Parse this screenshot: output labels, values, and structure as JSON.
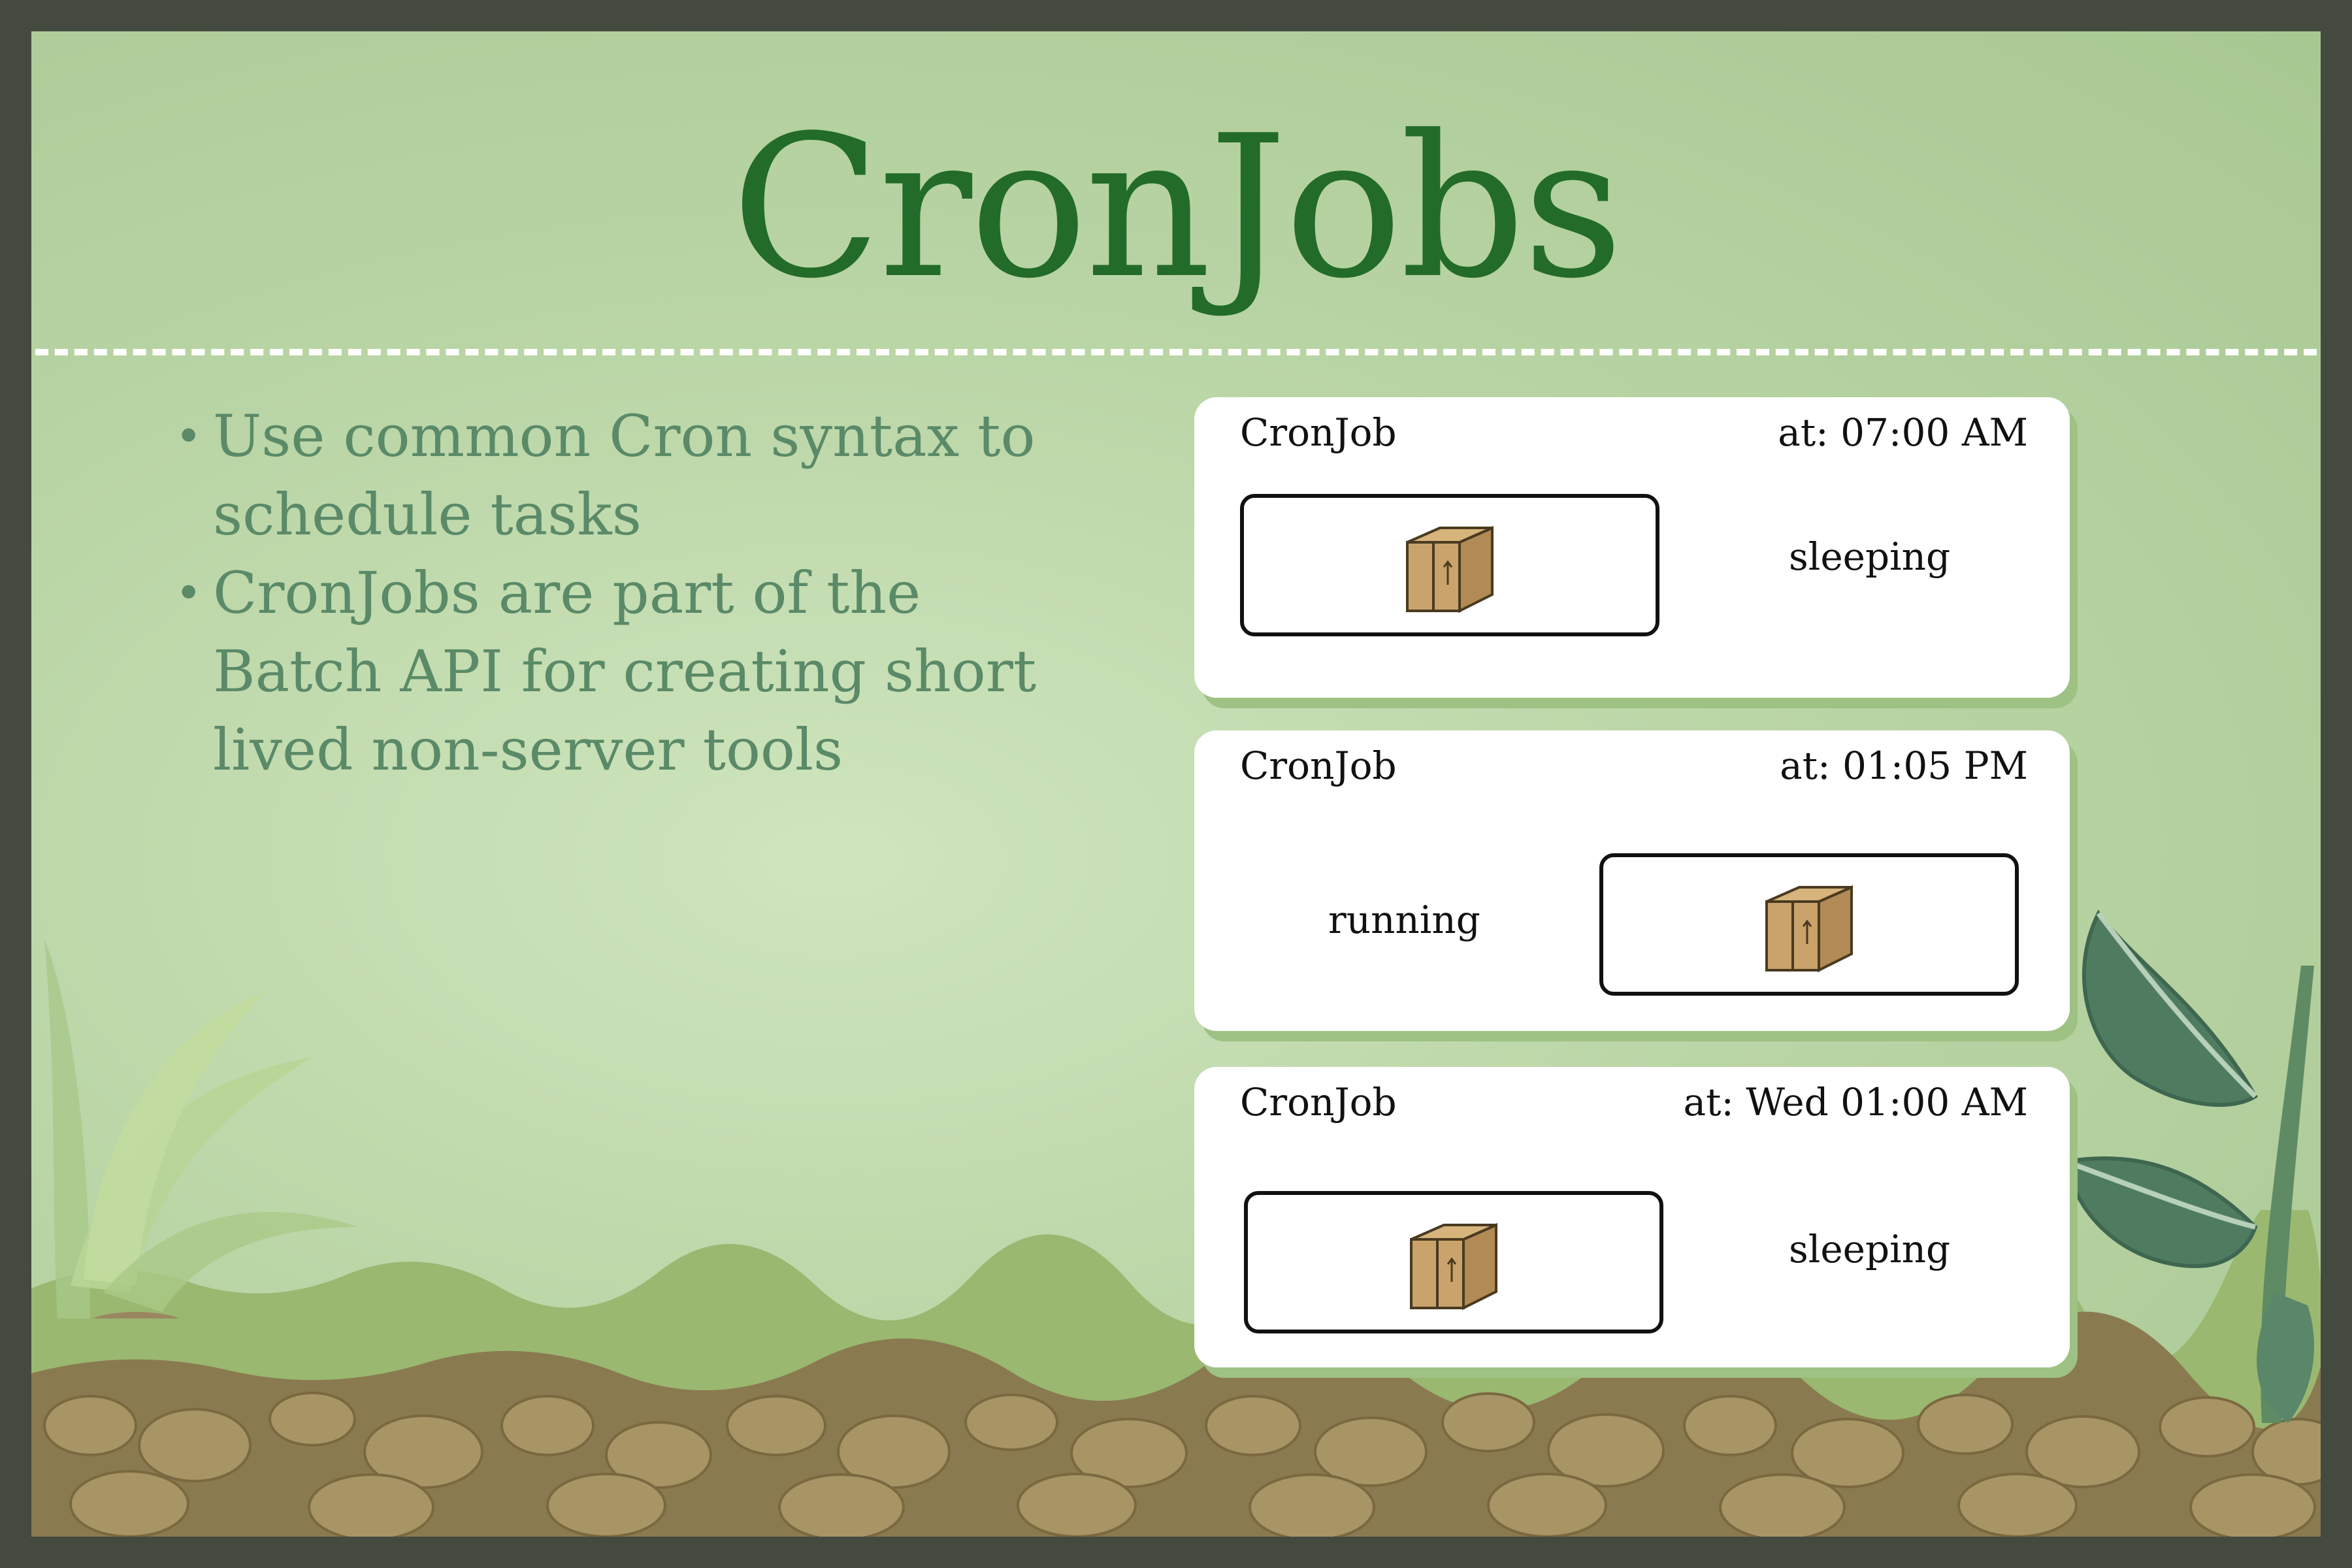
{
  "slide": {
    "title": "CronJobs",
    "bullets": [
      "Use common Cron syntax to schedule tasks",
      "CronJobs are part of the Batch API for creating short lived non-server tools"
    ],
    "bullet_symbol": "•"
  },
  "cards": [
    {
      "title": "CronJob",
      "time": "at: 07:00 AM",
      "status": "sleeping"
    },
    {
      "title": "CronJob",
      "time": "at: 01:05 PM",
      "status": "running"
    },
    {
      "title": "CronJob",
      "time": "at: Wed 01:00 AM",
      "status": "sleeping"
    }
  ],
  "icons": {
    "package": "package-icon",
    "divider": "dashed-divider"
  },
  "colors": {
    "title": "#236b28",
    "bullets": "#5a8a68",
    "card": "#ffffff",
    "frame": "#454a40"
  }
}
